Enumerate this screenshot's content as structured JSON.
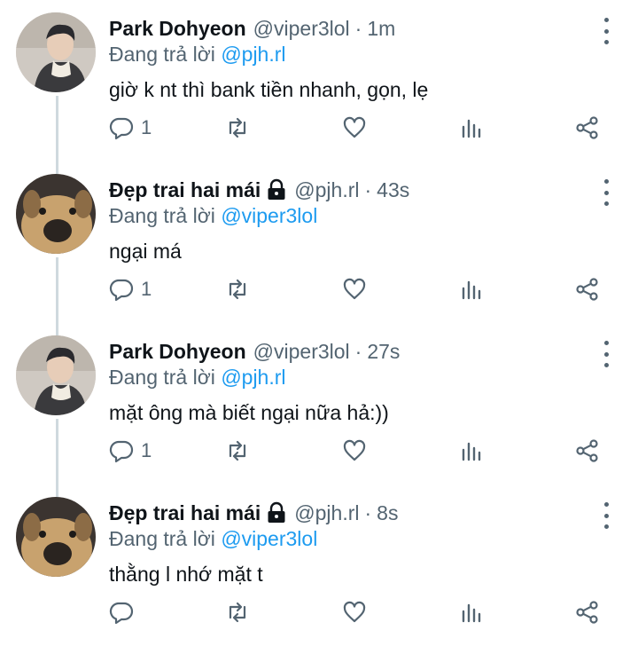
{
  "tweets": [
    {
      "author_name": "Park Dohyeon",
      "author_handle": "@viper3lol",
      "protected": false,
      "separator": "·",
      "time": "1m",
      "replying_prefix": "Đang trả lời",
      "replying_to": "@pjh.rl",
      "text": "giờ k nt thì bank tiền nhanh, gọn, lẹ",
      "reply_count": "1",
      "avatar": "person-avatar"
    },
    {
      "author_name": "Đẹp trai hai mái",
      "author_handle": "@pjh.rl",
      "protected": true,
      "separator": "·",
      "time": "43s",
      "replying_prefix": "Đang trả lời",
      "replying_to": "@viper3lol",
      "text": "ngại má",
      "reply_count": "1",
      "avatar": "dog-avatar"
    },
    {
      "author_name": "Park Dohyeon",
      "author_handle": "@viper3lol",
      "protected": false,
      "separator": "·",
      "time": "27s",
      "replying_prefix": "Đang trả lời",
      "replying_to": "@pjh.rl",
      "text": "mặt ông mà biết ngại nữa hả:))",
      "reply_count": "1",
      "avatar": "person-avatar"
    },
    {
      "author_name": "Đẹp trai hai mái",
      "author_handle": "@pjh.rl",
      "protected": true,
      "separator": "·",
      "time": "8s",
      "replying_prefix": "Đang trả lời",
      "replying_to": "@viper3lol",
      "text": "thằng l nhớ mặt t",
      "reply_count": "",
      "avatar": "dog-avatar"
    }
  ],
  "icons": {
    "reply": "reply-icon",
    "retweet": "retweet-icon",
    "like": "like-icon",
    "analytics": "analytics-icon",
    "share": "share-icon",
    "menu": "more-options-icon",
    "lock": "lock-icon"
  },
  "colors": {
    "text": "#0f1419",
    "secondary": "#536471",
    "mention": "#1d9bf0",
    "thread_line": "#cfd9de"
  }
}
